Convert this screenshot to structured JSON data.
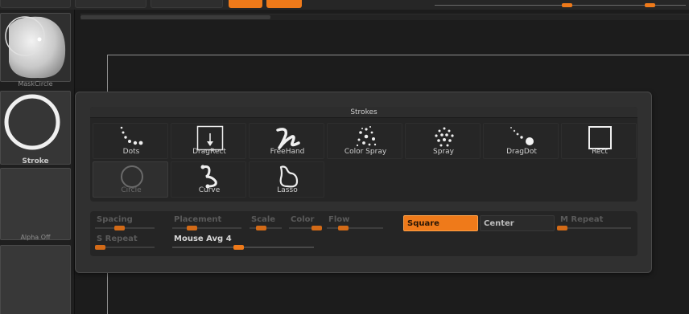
{
  "panel": {
    "title": "Strokes"
  },
  "sidebar": {
    "mask_label": "MaskCircle",
    "stroke_label": "Stroke",
    "alpha_label": "Alpha Off"
  },
  "strokes": [
    {
      "label": "Dots",
      "icon": "dots-stroke-icon"
    },
    {
      "label": "DragRect",
      "icon": "dragrect-stroke-icon"
    },
    {
      "label": "FreeHand",
      "icon": "freehand-stroke-icon"
    },
    {
      "label": "Color Spray",
      "icon": "colorspray-stroke-icon"
    },
    {
      "label": "Spray",
      "icon": "spray-stroke-icon"
    },
    {
      "label": "DragDot",
      "icon": "dragdot-stroke-icon"
    },
    {
      "label": "Rect",
      "icon": "rect-stroke-icon"
    },
    {
      "label": "Circle",
      "icon": "circle-stroke-icon",
      "selected": true
    },
    {
      "label": "Curve",
      "icon": "curve-stroke-icon"
    },
    {
      "label": "Lasso",
      "icon": "lasso-stroke-icon"
    }
  ],
  "settings": {
    "spacing": "Spacing",
    "placement": "Placement",
    "scale": "Scale",
    "color": "Color",
    "flow": "Flow",
    "square": "Square",
    "center": "Center",
    "m_repeat": "M Repeat",
    "s_repeat": "S Repeat",
    "mouse_avg": "Mouse Avg 4"
  },
  "colors": {
    "accent": "#ef7a1a",
    "panel": "#252525",
    "background": "#1c1c1c"
  }
}
